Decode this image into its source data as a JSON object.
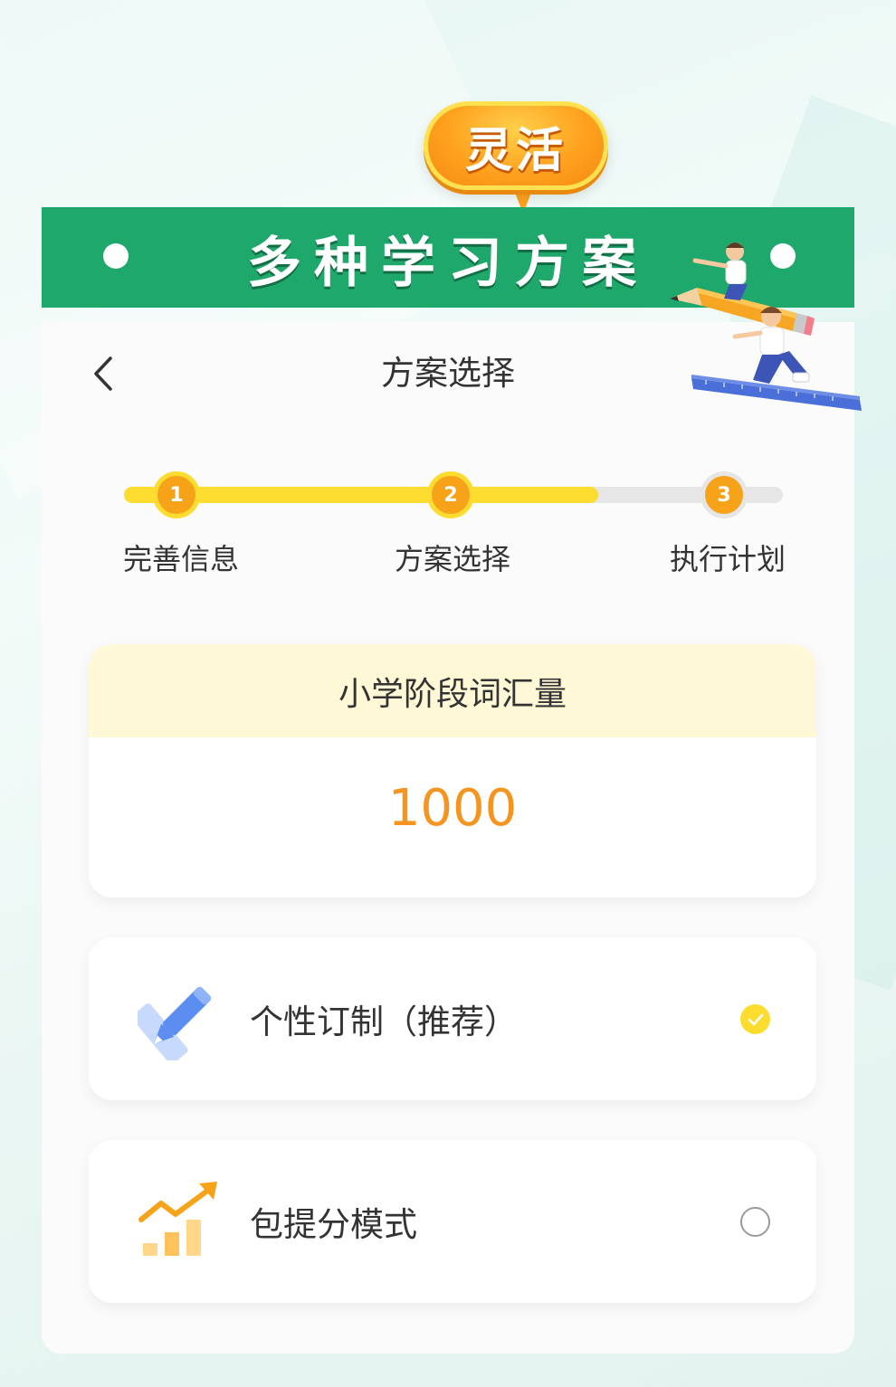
{
  "badge": {
    "text": "灵活"
  },
  "banner": {
    "title": "多种学习方案"
  },
  "nav": {
    "title": "方案选择",
    "back_icon": "chevron-left-icon"
  },
  "steps": [
    {
      "number": "1",
      "label": "完善信息",
      "state": "done"
    },
    {
      "number": "2",
      "label": "方案选择",
      "state": "current"
    },
    {
      "number": "3",
      "label": "执行计划",
      "state": "pending"
    }
  ],
  "progress_fraction": 0.72,
  "vocab": {
    "title": "小学阶段词汇量",
    "value": "1000"
  },
  "options": [
    {
      "label": "个性订制（推荐）",
      "icon": "pencil-ruler-icon",
      "selected": true
    },
    {
      "label": "包提分模式",
      "icon": "growth-chart-icon",
      "selected": false
    }
  ],
  "colors": {
    "green": "#1fa86b",
    "yellow": "#fcdc2e",
    "orange": "#f7a31a",
    "value_orange": "#f5941f",
    "vocab_header": "#fff8d7"
  }
}
